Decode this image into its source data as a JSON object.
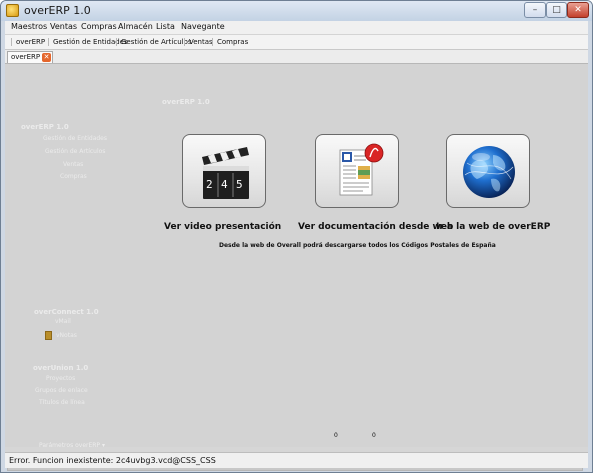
{
  "window": {
    "title": "overERP 1.0"
  },
  "menu": [
    "Maestros",
    "Ventas",
    "Compras",
    "Almacén",
    "Lista",
    "Navegante"
  ],
  "toolbar": {
    "items": [
      "overERP",
      "Gestión de Entidades",
      "Gestión de Artículos",
      "Ventas",
      "Compras"
    ]
  },
  "tab": {
    "label": "overERP"
  },
  "sidebar": {
    "header_title": "overERP 1.0",
    "overerp": {
      "title": "overERP 1.0",
      "items": [
        "Gestión de Entidades",
        "Gestión de Artículos",
        "Ventas",
        "Compras"
      ]
    },
    "overconnect": {
      "title": "overConnect 1.0",
      "items": [
        "vMail",
        "vNotas"
      ]
    },
    "overunion": {
      "title": "overUnion 1.0",
      "items": [
        "Proyectos",
        "Grupos de enlace",
        "Títulos de línea"
      ]
    },
    "parameters_label": "Parámetros overERP ▾"
  },
  "actions": [
    {
      "label": "Ver video presentación",
      "icon": "clapperboard-icon"
    },
    {
      "label": "Ver documentación desde web",
      "icon": "pdf-document-icon"
    },
    {
      "label": "Ir a la web de overERP",
      "icon": "globe-icon"
    }
  ],
  "info": {
    "text": "Desde la web de Overall podrá descargarse todos los Códigos Postales de España"
  },
  "counters": {
    "left": "0",
    "right": "0"
  },
  "bottom_panel": {
    "left": "0",
    "right": "0"
  },
  "status": {
    "text": "Error. Funcion inexistente: 2c4uvbg3.vcd@CSS_CSS"
  },
  "colors": {
    "titlebar": "#c9d8ea",
    "content_bg": "#d3d3d3",
    "close_button": "#c3402c"
  }
}
